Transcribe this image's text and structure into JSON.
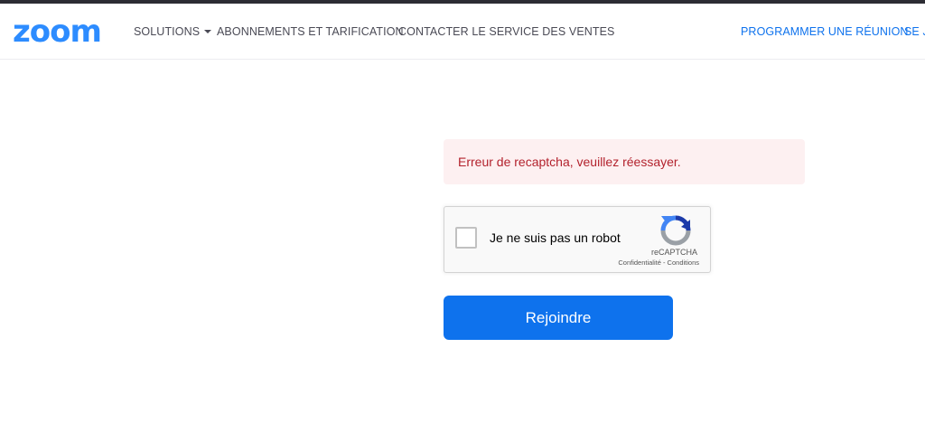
{
  "header": {
    "logo_text": "zoom",
    "nav_left": {
      "solutions": "SOLUTIONS",
      "plans": "ABONNEMENTS ET TARIFICATION",
      "contact_sales": "CONTACTER LE SERVICE DES VENTES"
    },
    "nav_right": {
      "schedule": "PROGRAMMER UNE RÉUNION",
      "join_partial": "SE JO"
    },
    "brand_color": "#2d8cff"
  },
  "alert": {
    "message": "Erreur de recaptcha, veuillez réessayer.",
    "text_color": "#b3222d",
    "background": "#fdf0f1"
  },
  "recaptcha": {
    "label": "Je ne suis pas un robot",
    "checked": false,
    "brand": "reCAPTCHA",
    "links": "Confidentialité - Conditions",
    "icon": "recaptcha-logo-icon"
  },
  "join": {
    "button_label": "Rejoindre",
    "button_color": "#0e72ed"
  }
}
